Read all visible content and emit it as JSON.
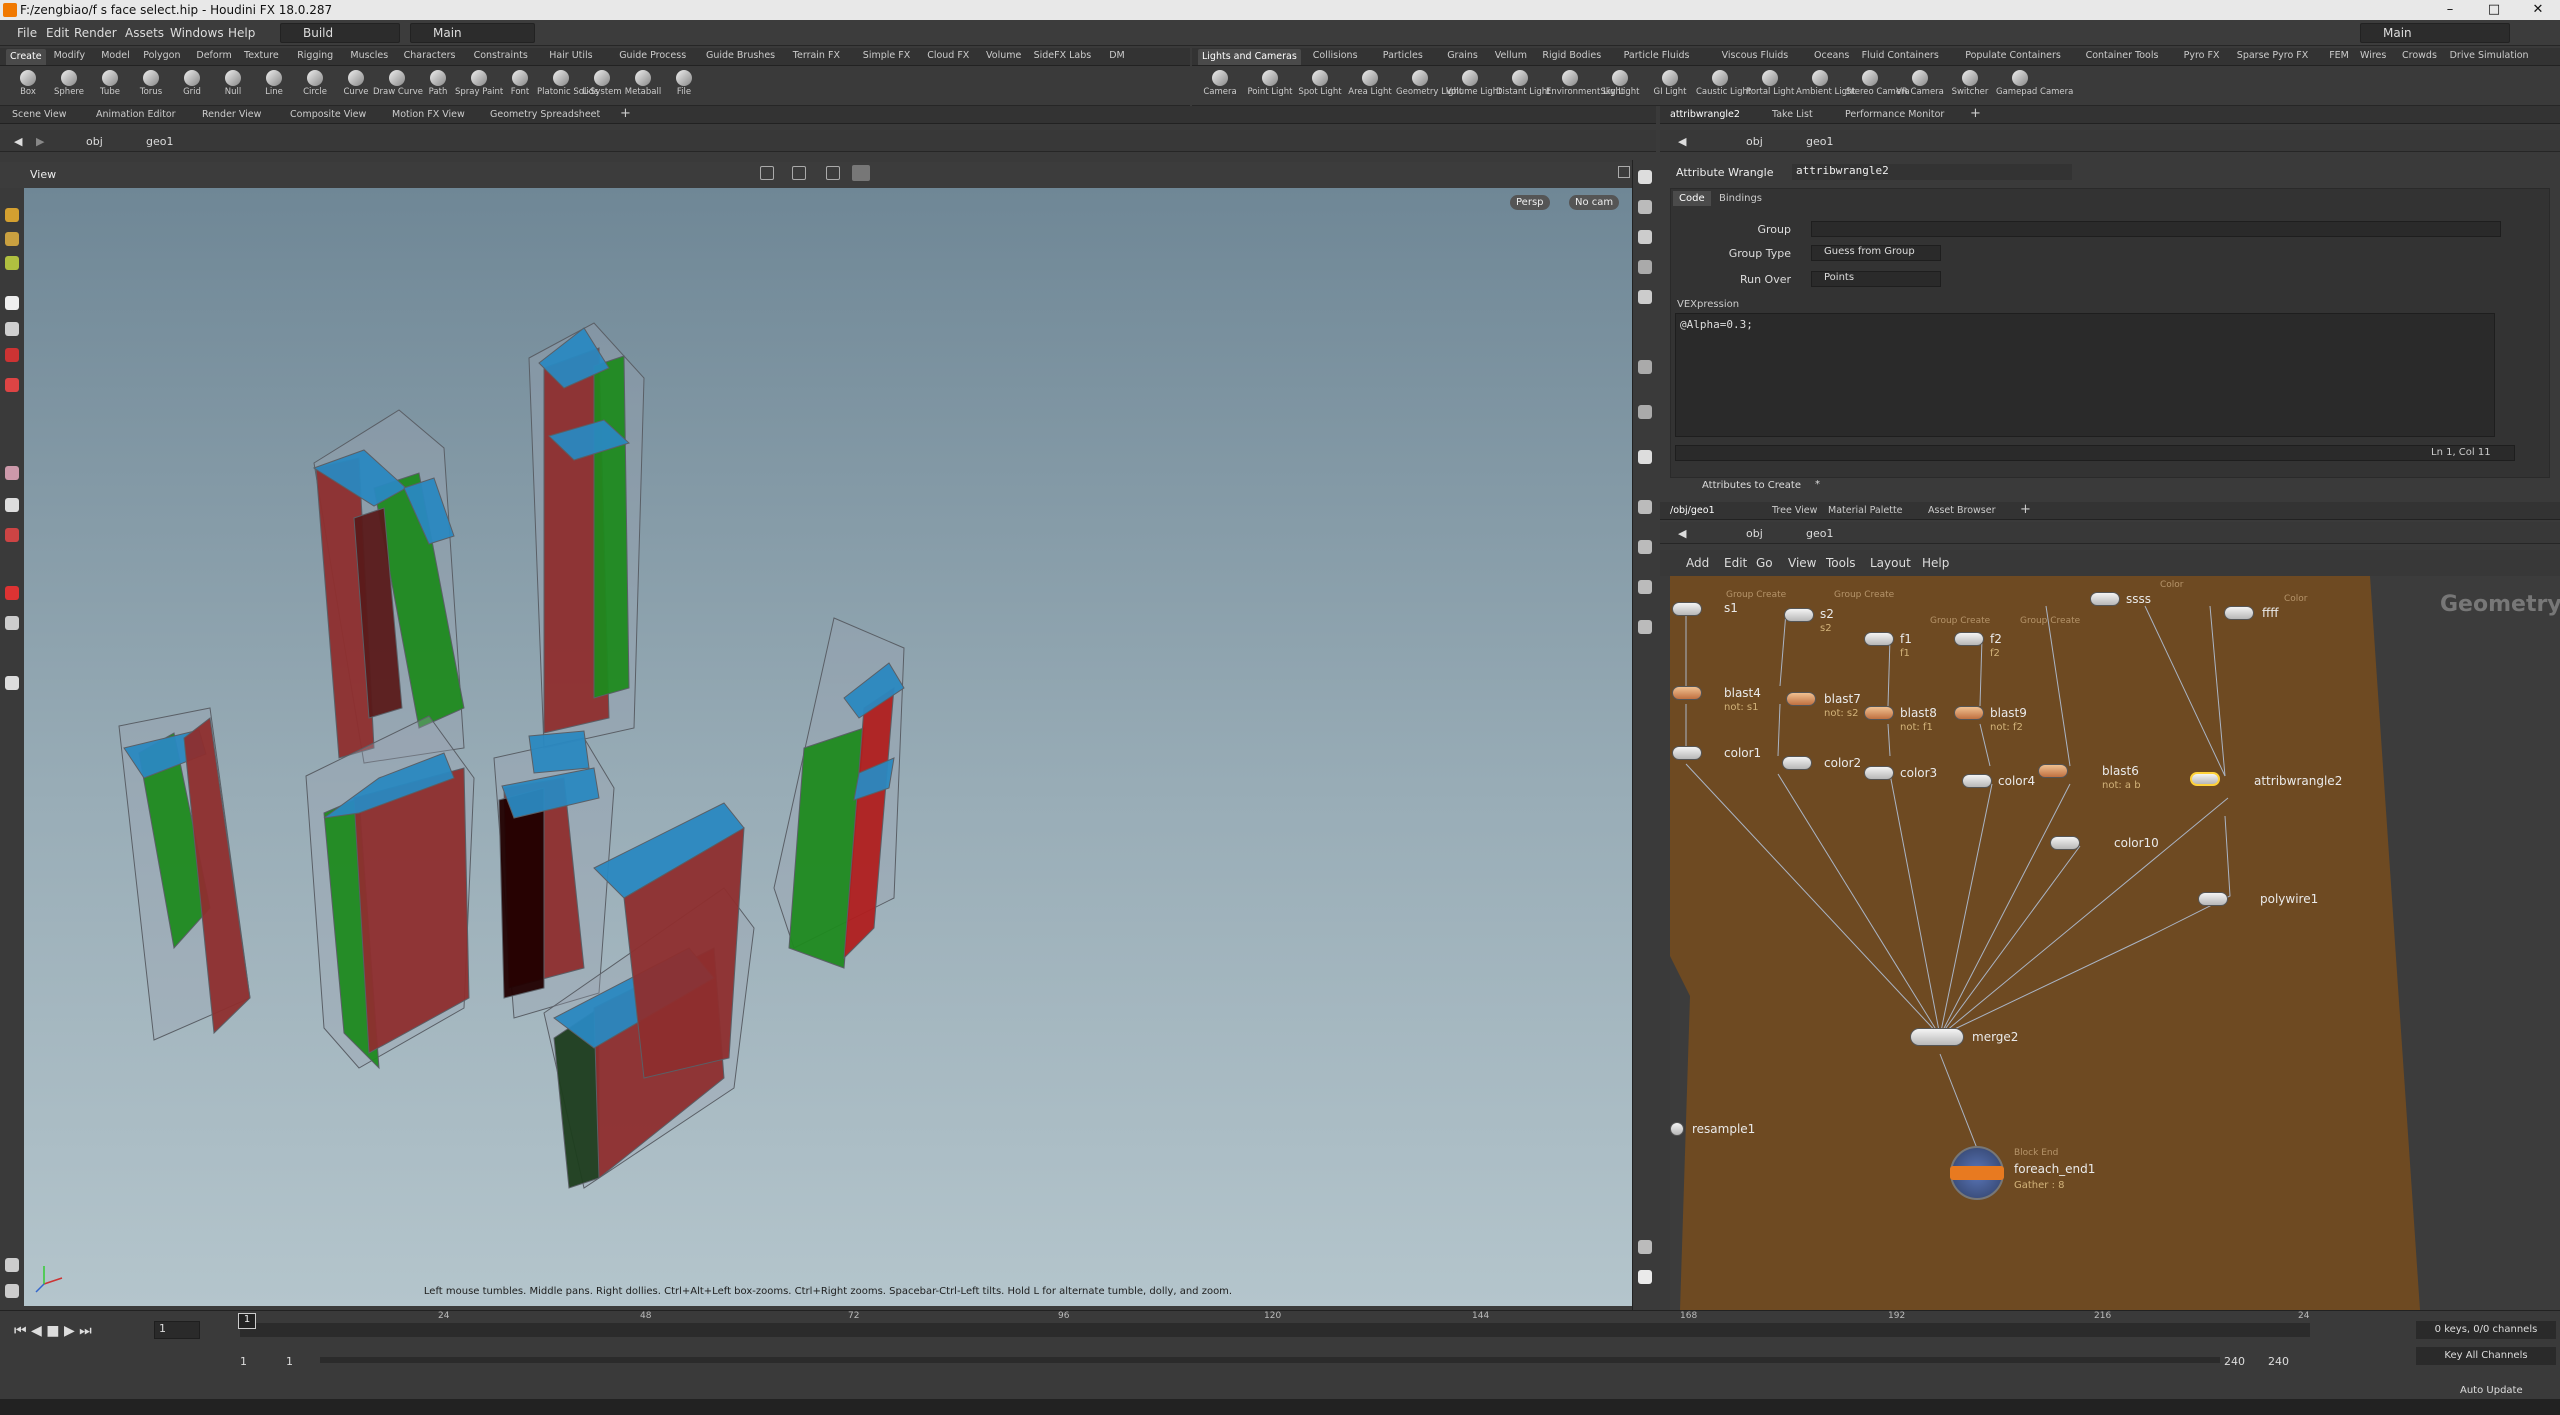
{
  "window": {
    "title": "F:/zengbiao/f s face select.hip - Houdini FX 18.0.287",
    "controls": [
      "–",
      "□",
      "✕"
    ]
  },
  "menubar": {
    "items": [
      "File",
      "Edit",
      "Render",
      "Assets",
      "Windows",
      "Help"
    ],
    "desktop": "Build",
    "context": "Main",
    "right_desktop": "Main"
  },
  "shelf_left": {
    "tabs": [
      "Create",
      "Modify",
      "Model",
      "Polygon",
      "Deform",
      "Texture",
      "Rigging",
      "Muscles",
      "Characters",
      "Constraints",
      "Hair Utils",
      "Guide Process",
      "Guide Brushes",
      "Terrain FX",
      "Simple FX",
      "Cloud FX",
      "Volume",
      "SideFX Labs",
      "DM"
    ],
    "tools": [
      "Box",
      "Sphere",
      "Tube",
      "Torus",
      "Grid",
      "Null",
      "Line",
      "Circle",
      "Curve",
      "Draw Curve",
      "Path",
      "Spray Paint",
      "Font",
      "Platonic Solids",
      "L-System",
      "Metaball",
      "File"
    ]
  },
  "shelf_right": {
    "tabs": [
      "Lights and Cameras",
      "Collisions",
      "Particles",
      "Grains",
      "Vellum",
      "Rigid Bodies",
      "Particle Fluids",
      "Viscous Fluids",
      "Oceans",
      "Fluid Containers",
      "Populate Containers",
      "Container Tools",
      "Pyro FX",
      "Sparse Pyro FX",
      "FEM",
      "Wires",
      "Crowds",
      "Drive Simulation"
    ],
    "tools": [
      "Camera",
      "Point Light",
      "Spot Light",
      "Area Light",
      "Geometry Light",
      "Volume Light",
      "Distant Light",
      "Environment Light",
      "Sky Light",
      "GI Light",
      "Caustic Light",
      "Portal Light",
      "Ambient Light",
      "Stereo Camera",
      "VR Camera",
      "Switcher",
      "Gamepad Camera"
    ]
  },
  "left_pane": {
    "tabs": [
      "Scene View",
      "Animation Editor",
      "Render View",
      "Composite View",
      "Motion FX View",
      "Geometry Spreadsheet"
    ],
    "path": [
      "obj",
      "geo1"
    ],
    "view_label": "View",
    "persp": "Persp",
    "cam": "No cam",
    "hint": "Left mouse tumbles. Middle pans. Right dollies. Ctrl+Alt+Left box-zooms. Ctrl+Right zooms. Spacebar-Ctrl-Left tilts. Hold L for alternate tumble, dolly, and zoom."
  },
  "param_pane": {
    "tabs": [
      "attribwrangle2",
      "Take List",
      "Performance Monitor"
    ],
    "path": [
      "obj",
      "geo1"
    ],
    "node_type": "Attribute Wrangle",
    "node_name": "attribwrangle2",
    "subtabs": [
      "Code",
      "Bindings"
    ],
    "group_label": "Group",
    "group_value": "",
    "group_type_label": "Group Type",
    "group_type_value": "Guess from Group",
    "run_over_label": "Run Over",
    "run_over_value": "Points",
    "vex_label": "VEXpression",
    "vex_code": "@Alpha=0.3;",
    "cursor": "Ln 1, Col 11",
    "attributes_to_create": "Attributes to Create",
    "attr_value": "*"
  },
  "net_pane": {
    "tabs": [
      "/obj/geo1",
      "Tree View",
      "Material Palette",
      "Asset Browser"
    ],
    "path": [
      "obj",
      "geo1"
    ],
    "menu": [
      "Add",
      "Edit",
      "Go",
      "View",
      "Tools",
      "Layout",
      "Help"
    ],
    "context_label": "Geometry",
    "nodes": [
      {
        "name": "s1",
        "sub": "",
        "hint": "Group Create"
      },
      {
        "name": "s2",
        "sub": "s2",
        "hint": "Group Create"
      },
      {
        "name": "ssss",
        "sub": "",
        "hint": "Color"
      },
      {
        "name": "ffff",
        "sub": "",
        "hint": "Color"
      },
      {
        "name": "f1",
        "sub": "f1",
        "hint": "Group Create"
      },
      {
        "name": "f2",
        "sub": "f2",
        "hint": "Group Create"
      },
      {
        "name": "blast4",
        "sub": "not: s1",
        "hint": ""
      },
      {
        "name": "blast7",
        "sub": "not: s2",
        "hint": ""
      },
      {
        "name": "blast8",
        "sub": "not: f1",
        "hint": ""
      },
      {
        "name": "blast9",
        "sub": "not: f2",
        "hint": ""
      },
      {
        "name": "color1",
        "sub": "",
        "hint": ""
      },
      {
        "name": "color2",
        "sub": "",
        "hint": ""
      },
      {
        "name": "color3",
        "sub": "",
        "hint": ""
      },
      {
        "name": "color4",
        "sub": "",
        "hint": ""
      },
      {
        "name": "blast6",
        "sub": "not: a b",
        "hint": ""
      },
      {
        "name": "attribwrangle2",
        "sub": "",
        "hint": ""
      },
      {
        "name": "color10",
        "sub": "",
        "hint": ""
      },
      {
        "name": "polywire1",
        "sub": "",
        "hint": ""
      },
      {
        "name": "merge2",
        "sub": "",
        "hint": ""
      },
      {
        "name": "resample1",
        "sub": "",
        "hint": ""
      },
      {
        "name": "foreach_end1",
        "sub": "Gather : 8",
        "hint": "Block End"
      }
    ]
  },
  "timeline": {
    "ticks": [
      "24",
      "48",
      "72",
      "96",
      "120",
      "144",
      "168",
      "192",
      "216",
      "24"
    ],
    "frame": "1",
    "start": "1",
    "end_a": "1",
    "range_end": "240",
    "range_end2": "240",
    "keys": "0 keys, 0/0 channels",
    "key_all": "Key All Channels",
    "auto_update": "Auto Update",
    "current_marker": "1"
  },
  "colors": {
    "bg": "#3a3a3a",
    "network": "#6e4a22",
    "top": "#2a88c0",
    "red": "#8e2e2e",
    "green": "#1f8a1f",
    "accent": "#f07800"
  }
}
